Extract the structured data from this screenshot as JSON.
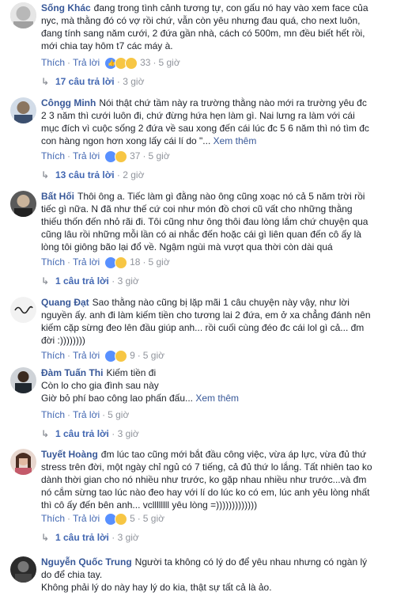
{
  "comments": [
    {
      "name": "Sống Khác",
      "lines": [
        "đang trong tình cảnh tương tự, con gấu nó hay vào xem face của",
        "nyc, mà thằng đó có vợ rồi chứ, vẫn còn yêu nhưng đau quá, cho next luôn,",
        "đang tính sang năm cưới, 2 đứa gần nhà, cách có 500m, mn đều biết hết rồi,",
        "mới chia tay hôm t7 các máy à."
      ],
      "more": "",
      "like": "Thích",
      "reply": "Trả lời",
      "time": "5 giờ",
      "react_count": "33",
      "replies": "17 câu trả lời",
      "replies_time": "3 giờ"
    },
    {
      "name": "Công̣g Minh",
      "lines": [
        "Nói thật chứ tầm này ra trường thằng nào mới ra trường yêu đc",
        "2 3 năm thì cưới luôn đi, chứ đừng hứa hẹn làm gì. Nai lưng ra làm với cái",
        "mục đích vì cuộc sống 2 đứa về sau xong đến cái lúc đc 5 6 năm thì nó tìm đc",
        "con hàng ngon hơn xong lấy cái lí do \"..."
      ],
      "more": "Xem thêm",
      "like": "Thích",
      "reply": "Trả lời",
      "time": "5 giờ",
      "react_count": "37",
      "replies": "13 câu trả lời",
      "replies_time": "2 giờ"
    },
    {
      "name": "Bất Hối",
      "lines": [
        "Thôi ông a. Tiếc làm gì đằng nào ông cũng xoạc nó cả 5 năm trời rồi",
        "tiếc gì nữa. N đã như thế cứ coi như món đồ chơi cũ vất cho những thằng",
        "thiếu thốn đến nhỏ rãi đi. Tôi cũng như ông thôi đau lòng lắm chứ chuyện qua",
        "cũng lâu rồi những mỗi lần có ai nhắc đến hoặc cái gì liên quan đến cô ấy là",
        "lòng tôi giông bão lại đổ về. Ngậm ngùi mà vượt qua thời còn dài quá"
      ],
      "more": "",
      "like": "Thích",
      "reply": "Trả lời",
      "time": "5 giờ",
      "react_count": "18",
      "replies": "1 câu trả lời",
      "replies_time": "3 giờ"
    },
    {
      "name": "Quang Đạt",
      "lines": [
        "Sao thằng nào cũng bị lặp mãi 1 câu chuyện này vậy, như lời",
        "nguyền ấy. anh đi làm kiếm tiền cho tương lai 2 đứa, em ở xa chẳng đánh nên",
        "kiếm cặp sừng đeo lên đầu giúp anh... rồi cuối cùng đéo đc cái lol gì cả... đm",
        "đời :))))))))"
      ],
      "more": "",
      "like": "Thích",
      "reply": "Trả lời",
      "time": "5 giờ",
      "react_count": "9",
      "replies": "",
      "replies_time": ""
    },
    {
      "name": "Đàm Tuấn Thi",
      "lines": [
        "Kiếm tiền đi",
        "Còn lo cho gia đình sau này",
        "Giờ bỏ phí bao công lao phấn đấu..."
      ],
      "more": "Xem thêm",
      "like": "Thích",
      "reply": "Trả lời",
      "time": "5 giờ",
      "react_count": "",
      "replies": "1 câu trả lời",
      "replies_time": "3 giờ"
    },
    {
      "name": "Tuyết Hoàng",
      "lines": [
        "đm lúc tao cũng mới bắt đầu công việc, vừa áp lực, vừa đủ thứ",
        "stress trên đời, một ngày chỉ ngủ có 7 tiếng, cả đủ thứ lo lắng. Tất nhiên tao ko",
        "dành thời gian cho nó nhiều như trước, ko gặp nhau nhiều như trước...và đm",
        "nó cắm sừng tao lúc nào đeo hay với lí do lúc ko có em, lúc anh yêu lòng nhất",
        "thì cô ấy đến bên anh... vcllllllll yêu lòng =)))))))))))))"
      ],
      "more": "",
      "like": "Thích",
      "reply": "Trả lời",
      "time": "5 giờ",
      "react_count": "5",
      "replies": "1 câu trả lời",
      "replies_time": "3 giờ"
    },
    {
      "name": "Nguyễn Quốc Trung",
      "lines": [
        "Người ta không có lý do để yêu nhau nhưng có ngàn lý",
        "do để chia tay.",
        "Không phải lý do này hay lý do kia, thật sự tất cả là ảo."
      ],
      "more": "",
      "like": "",
      "reply": "",
      "time": "",
      "react_count": "",
      "replies": "",
      "replies_time": ""
    }
  ],
  "colors": {
    "name": "#385898",
    "link": "#4267b2",
    "meta": "#90949c",
    "text": "#1d2129"
  }
}
